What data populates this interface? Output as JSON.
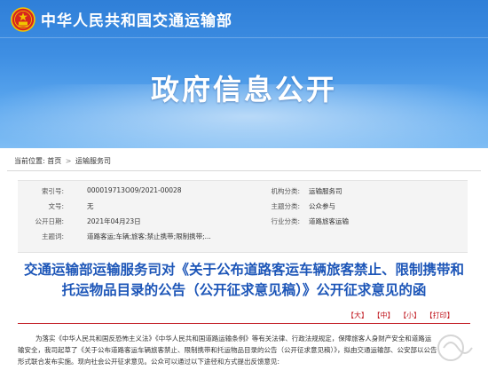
{
  "header": {
    "ministry_name": "中华人民共和国交通运输部",
    "banner_title": "政府信息公开",
    "emblem_icon": "national-emblem-icon"
  },
  "breadcrumb": {
    "prefix": "当前位置:",
    "items": [
      "首页",
      "运输服务司"
    ],
    "separator": ">"
  },
  "meta": {
    "rows": [
      {
        "k1": "索引号:",
        "v1": "000019713O09/2021-00028",
        "k2": "机构分类:",
        "v2": "运输服务司"
      },
      {
        "k1": "文号:",
        "v1": "无",
        "k2": "主题分类:",
        "v2": "公众参与"
      },
      {
        "k1": "公开日期:",
        "v1": "2021年04月23日",
        "k2": "行业分类:",
        "v2": "道路旅客运输"
      },
      {
        "k1": "主题词:",
        "v1": "道路客运;车辆;旅客;禁止携带;限制携带;...",
        "k2": "",
        "v2": ""
      }
    ]
  },
  "document": {
    "title": "交通运输部运输服务司对《关于公布道路客运车辆旅客禁止、限制携带和托运物品目录的公告（公开征求意见稿）》公开征求意见的函",
    "font_controls": [
      "【大】",
      "【中】",
      "【小】",
      "【打印】"
    ],
    "body_lines": [
      "为落实《中华人民共和国反恐怖主义法》《中华人民共和国道路运输条例》等有关法律、行政法规规定，保障旅客人身财产安全和道路运",
      "输安全，我司起草了《关于公布道路客运车辆旅客禁止、限制携带和托运物品目录的公告（公开征求意见稿）》，拟由交通运输部、公安部以公告",
      "形式联合发布实施。现向社会公开征求意见。公众可以通过以下途径和方式提出反馈意见:"
    ]
  },
  "colors": {
    "header_top": "#2f7fd8",
    "title_blue": "#1d56b8",
    "accent_red": "#c0141c"
  }
}
